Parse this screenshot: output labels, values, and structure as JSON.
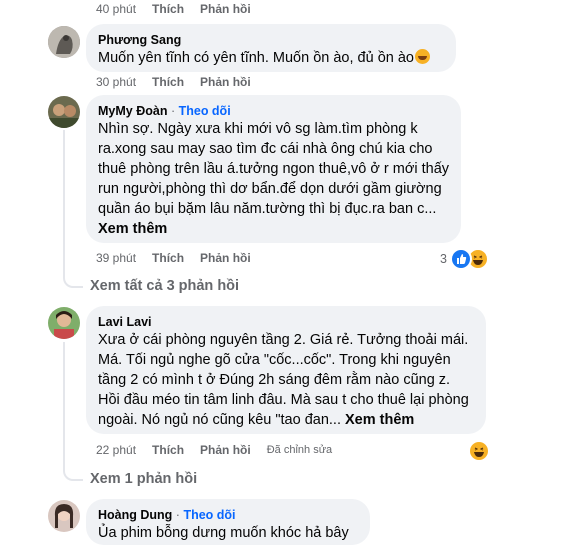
{
  "comments": [
    {
      "actions": {
        "time": "40 phút",
        "like": "Thích",
        "reply": "Phản hồi"
      }
    },
    {
      "author": "Phương Sang",
      "text": "Muốn yên tĩnh có yên tĩnh. Muốn ồn ào, đủ ồn ào",
      "actions": {
        "time": "30 phút",
        "like": "Thích",
        "reply": "Phản hồi"
      }
    },
    {
      "author": "MyMy Đoàn",
      "separator": "·",
      "follow": "Theo dõi",
      "text": "Nhìn sợ. Ngày xưa khi mới vô sg làm.tìm phòng k ra.xong sau may sao tìm đc cái nhà ông chú kia cho thuê phòng trên lầu á.tưởng ngon thuê,vô ở r mới thấy run người,phòng thì dơ bẩn.để dọn dưới gầm giường quần áo bụi bặm lâu năm.tường thì bị đục.ra ban c...",
      "see_more": "Xem thêm",
      "actions": {
        "time": "39 phút",
        "like": "Thích",
        "reply": "Phản hồi"
      },
      "reaction_count": "3",
      "view_replies": "Xem tất cả 3 phản hồi"
    },
    {
      "author": "Lavi Lavi",
      "text": "Xưa ở cái phòng nguyên tầng 2. Giá rẻ. Tưởng thoải mái. Má. Tối ngủ nghe gõ cửa \"cốc...cốc\". Trong khi nguyên tầng 2 có mình t ở Đúng 2h sáng đêm rằm nào cũng z. Hồi đầu méo tin tâm linh đâu. Mà sau t cho thuê lại phòng ngoài. Nó ngủ nó cũng kêu \"tao đan...",
      "see_more": "Xem thêm",
      "actions": {
        "time": "22 phút",
        "like": "Thích",
        "reply": "Phản hồi",
        "edited": "Đã chỉnh sửa"
      },
      "view_replies": "Xem 1 phản hồi"
    },
    {
      "author": "Hoàng Dung",
      "separator": "·",
      "follow": "Theo dõi",
      "text": "Ủa phim bỗng dưng muốn khóc hả bây"
    }
  ],
  "icons": {
    "like": "like-reaction-icon",
    "haha": "haha-reaction-icon",
    "rofl": "rolling-laughing-emoji"
  },
  "colors": {
    "bubble": "#f0f2f5",
    "follow_link": "#0866ff",
    "meta_text": "#65676b",
    "like_blue": "#1877f2",
    "haha_yellow": "#f7b125"
  }
}
